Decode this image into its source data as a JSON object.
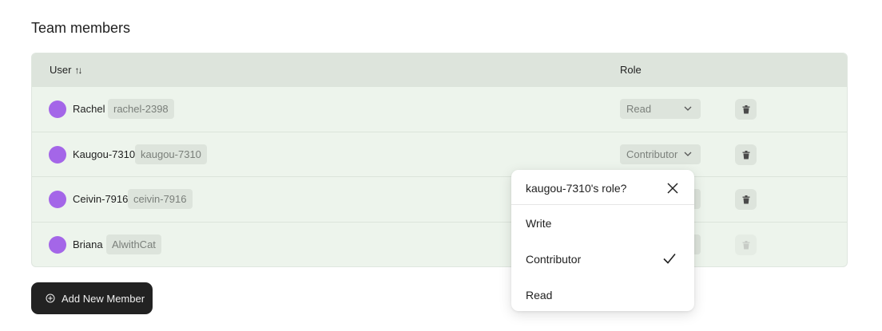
{
  "section": {
    "title": "Team members"
  },
  "table": {
    "headers": {
      "user": "User",
      "sort_icon": "↑↓",
      "role": "Role"
    },
    "rows": [
      {
        "name": "Rachel",
        "handle": "rachel-2398",
        "role": "Read",
        "delete_enabled": true
      },
      {
        "name": "Kaugou-7310",
        "handle": "kaugou-7310",
        "role": "Contributor",
        "delete_enabled": true
      },
      {
        "name": "Ceivin-7916",
        "handle": "ceivin-7916",
        "role": "",
        "delete_enabled": true
      },
      {
        "name": "Briana",
        "handle": "AlwithCat",
        "role": "",
        "delete_enabled": false
      }
    ]
  },
  "add_button": {
    "label": "Add New Member",
    "icon": "plus-circle-icon"
  },
  "role_popover": {
    "title": "kaugou-7310's role?",
    "options": [
      {
        "label": "Write",
        "selected": false
      },
      {
        "label": "Contributor",
        "selected": true
      },
      {
        "label": "Read",
        "selected": false
      }
    ]
  },
  "colors": {
    "avatar": "#a466e8",
    "table_bg": "#edf4ec",
    "header_bg": "#dde4dc",
    "button_bg": "#222222"
  }
}
